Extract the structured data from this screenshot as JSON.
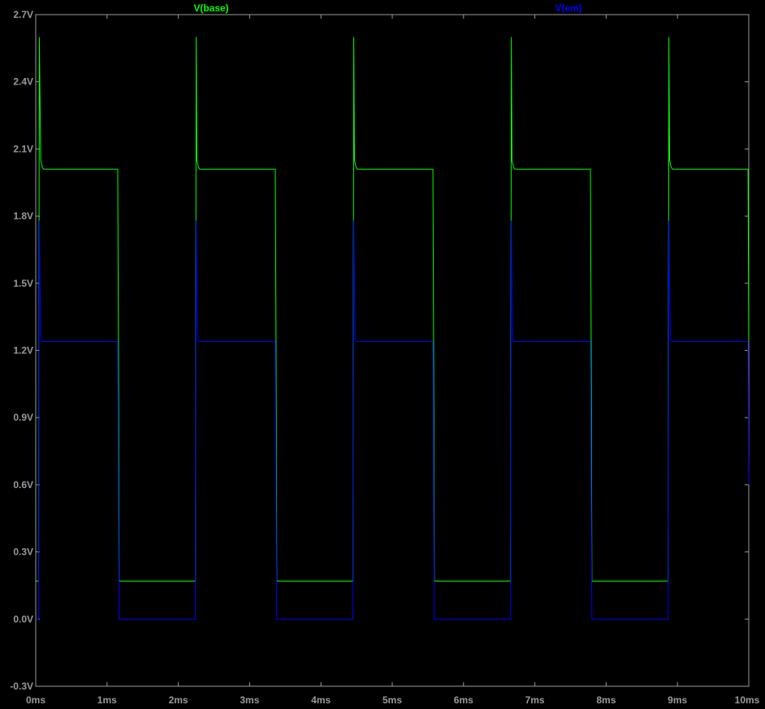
{
  "chart_data": {
    "type": "line",
    "title": "",
    "xlabel": "",
    "ylabel": "",
    "grid": false,
    "legend_placement": "top",
    "xlim": [
      0,
      10
    ],
    "ylim": [
      -0.3,
      2.7
    ],
    "x_ticks": [
      0,
      1,
      2,
      3,
      4,
      5,
      6,
      7,
      8,
      9,
      10
    ],
    "x_tick_labels": [
      "0ms",
      "1ms",
      "2ms",
      "3ms",
      "4ms",
      "5ms",
      "6ms",
      "7ms",
      "8ms",
      "9ms",
      "10ms"
    ],
    "y_ticks": [
      2.7,
      2.4,
      2.1,
      1.8,
      1.5,
      1.2,
      0.9,
      0.6,
      0.3,
      0.0,
      -0.3
    ],
    "y_tick_labels": [
      "2.7V",
      "2.4V",
      "2.1V",
      "1.8V",
      "1.5V",
      "1.2V",
      "0.9V",
      "0.6V",
      "0.3V",
      "0.0V",
      "-0.3V"
    ],
    "series": [
      {
        "name": "V(base)",
        "color": "#00ff00",
        "x": [
          0,
          0.04,
          0.05,
          0.07,
          0.09,
          0.11,
          1.15,
          1.16,
          1.17,
          2.24,
          2.25,
          2.26,
          2.28,
          2.3,
          3.36,
          3.37,
          3.38,
          4.45,
          4.46,
          4.47,
          4.49,
          4.51,
          5.57,
          5.58,
          5.59,
          6.66,
          6.67,
          6.68,
          6.7,
          6.72,
          7.78,
          7.79,
          7.8,
          8.87,
          8.88,
          8.89,
          8.91,
          8.93,
          9.99,
          10.0
        ],
        "y": [
          0.17,
          0.17,
          2.6,
          2.05,
          2.02,
          2.01,
          2.01,
          1.24,
          0.17,
          0.17,
          2.6,
          2.05,
          2.02,
          2.01,
          2.01,
          1.24,
          0.17,
          0.17,
          2.6,
          2.05,
          2.02,
          2.01,
          2.01,
          1.24,
          0.17,
          0.17,
          2.6,
          2.05,
          2.02,
          2.01,
          2.01,
          1.24,
          0.17,
          0.17,
          2.6,
          2.05,
          2.02,
          2.01,
          2.01,
          1.24
        ]
      },
      {
        "name": "V(em)",
        "color": "#0000ff",
        "x": [
          0,
          0.04,
          0.05,
          0.07,
          0.09,
          1.15,
          1.16,
          1.17,
          2.24,
          2.25,
          2.27,
          2.29,
          3.36,
          3.37,
          3.38,
          4.45,
          4.46,
          4.48,
          4.5,
          5.57,
          5.58,
          5.59,
          6.66,
          6.67,
          6.69,
          6.71,
          7.78,
          7.79,
          7.8,
          8.87,
          8.88,
          8.9,
          8.92,
          9.99,
          10.0
        ],
        "y": [
          0.0,
          0.0,
          1.78,
          1.25,
          1.24,
          1.24,
          0.6,
          0.0,
          0.0,
          1.78,
          1.25,
          1.24,
          1.24,
          0.6,
          0.0,
          0.0,
          1.78,
          1.25,
          1.24,
          1.24,
          0.6,
          0.0,
          0.0,
          1.78,
          1.25,
          1.24,
          1.24,
          0.6,
          0.0,
          0.0,
          1.78,
          1.25,
          1.24,
          1.24,
          0.6
        ]
      }
    ]
  }
}
